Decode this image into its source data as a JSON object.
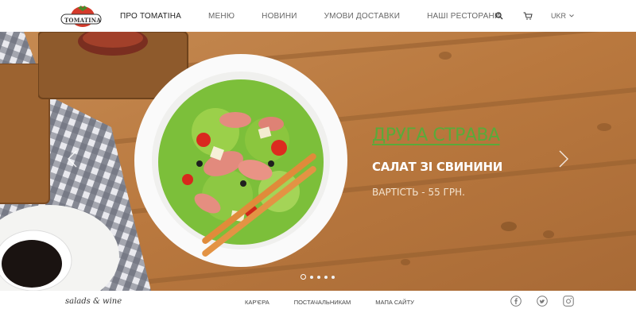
{
  "header": {
    "logo_text": "TOMATINA",
    "nav": [
      {
        "label": "ПРО ТОМАТІНА",
        "active": true
      },
      {
        "label": "МЕНЮ",
        "active": false
      },
      {
        "label": "НОВИНИ",
        "active": false
      },
      {
        "label": "УМОВИ ДОСТАВКИ",
        "active": false
      },
      {
        "label": "НАШІ РЕСТОРАНИ",
        "active": false
      }
    ],
    "icons": [
      "search-icon",
      "cart-icon"
    ],
    "language": "UKR"
  },
  "slider": {
    "kicker": "ДРУГА СТРАВА",
    "title": "САЛАТ ЗІ СВИНИНИ",
    "price": "ВАРТІСТЬ - 55 ГРН.",
    "dots_count": 5,
    "active_dot": 0
  },
  "footer": {
    "brand": "salads & wine",
    "links": [
      "КАР'ЄРА",
      "ПОСТАЧАЛЬНИКАМ",
      "МАПА САЙТУ"
    ],
    "social": [
      "facebook-icon",
      "twitter-icon",
      "instagram-icon"
    ]
  },
  "colors": {
    "accent_green": "#5aaa3a",
    "logo_red": "#d43a2a",
    "wood": "#b87a44"
  }
}
